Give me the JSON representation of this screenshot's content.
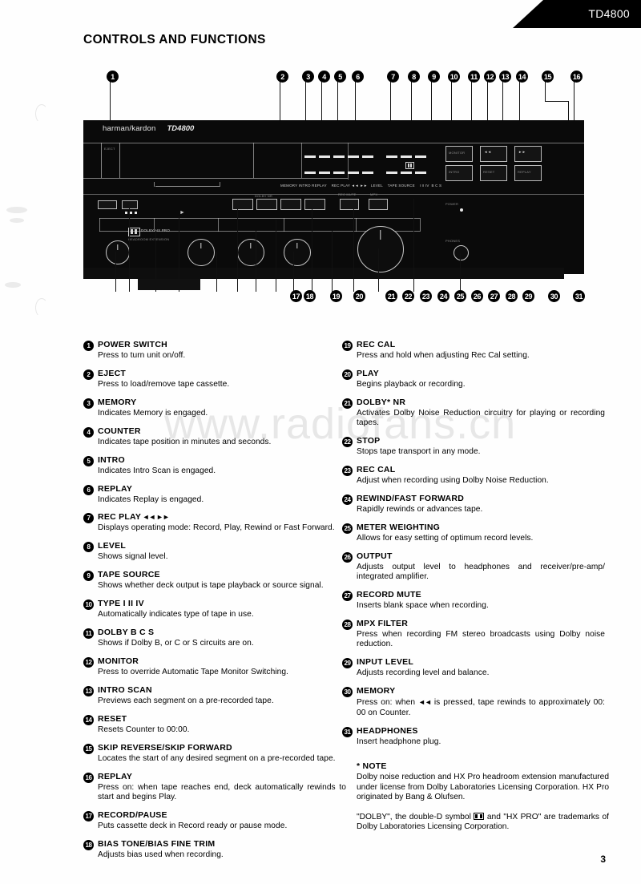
{
  "header": {
    "model": "TD4800"
  },
  "section_title": "CONTROLS AND FUNCTIONS",
  "page_number": "3",
  "watermark": "www.radiofans.cn",
  "illustration": {
    "brand": "harman/kardon",
    "model": "TD4800",
    "dolby_label": "DOLBY HX PRO",
    "dolby_sub": "HEADROOM EXTENSION",
    "callouts_top": [
      "1",
      "2",
      "3",
      "4",
      "5",
      "6",
      "7",
      "8",
      "9",
      "10",
      "11",
      "12",
      "13",
      "14",
      "15",
      "16"
    ],
    "callouts_bottom": [
      "17",
      "18",
      "19",
      "20",
      "21",
      "22",
      "23",
      "24",
      "25",
      "26",
      "27",
      "28",
      "29",
      "30",
      "31"
    ]
  },
  "left_column": [
    {
      "num": "1",
      "name": "POWER SWITCH",
      "desc": "Press to turn unit on/off."
    },
    {
      "num": "2",
      "name": "EJECT",
      "desc": "Press to load/remove tape cassette."
    },
    {
      "num": "3",
      "name": "MEMORY",
      "desc": "Indicates Memory is engaged."
    },
    {
      "num": "4",
      "name": "COUNTER",
      "desc": "Indicates tape position in minutes and seconds."
    },
    {
      "num": "5",
      "name": "INTRO",
      "desc": "Indicates Intro Scan is engaged."
    },
    {
      "num": "6",
      "name": "REPLAY",
      "desc": "Indicates Replay is engaged."
    },
    {
      "num": "7",
      "name": "REC PLAY",
      "name_suffix": "◄◄ ►►",
      "desc": "Displays operating mode: Record, Play, Rewind or Fast Forward."
    },
    {
      "num": "8",
      "name": "LEVEL",
      "desc": "Shows signal level."
    },
    {
      "num": "9",
      "name": "TAPE SOURCE",
      "desc": "Shows whether deck output is tape playback or source signal."
    },
    {
      "num": "10",
      "name": "TYPE I II IV",
      "desc": "Automatically indicates type of tape in use."
    },
    {
      "num": "11",
      "name": "DOLBY B C  S",
      "desc": "Shows if Dolby B, or C or S circuits are on."
    },
    {
      "num": "12",
      "name": "MONITOR",
      "desc": "Press to override Automatic Tape Monitor Switching."
    },
    {
      "num": "13",
      "name": "INTRO SCAN",
      "desc": "Previews each segment on a pre-recorded tape."
    },
    {
      "num": "14",
      "name": "RESET",
      "desc": "Resets Counter to 00:00."
    },
    {
      "num": "15",
      "name": "SKIP REVERSE/SKIP FORWARD",
      "desc": "Locates the start of any desired segment on a pre-recorded tape."
    },
    {
      "num": "16",
      "name": "REPLAY",
      "desc": "Press on: when tape reaches end, deck automatically rewinds to start and begins Play."
    },
    {
      "num": "17",
      "name": "RECORD/PAUSE",
      "desc": "Puts cassette deck in Record ready or pause mode."
    },
    {
      "num": "18",
      "name": "BIAS TONE/BIAS FINE TRIM",
      "desc": "Adjusts bias used when recording."
    }
  ],
  "right_column": [
    {
      "num": "19",
      "name": "REC CAL",
      "desc": "Press and hold when adjusting Rec Cal setting."
    },
    {
      "num": "20",
      "name": "PLAY",
      "desc": "Begins playback or recording."
    },
    {
      "num": "21",
      "name": "DOLBY* NR",
      "desc": "Activates Dolby Noise Reduction circuitry for playing or recording tapes."
    },
    {
      "num": "22",
      "name": "STOP",
      "desc": "Stops tape transport in any mode."
    },
    {
      "num": "23",
      "name": "REC CAL",
      "desc": "Adjust when recording using Dolby Noise Reduction."
    },
    {
      "num": "24",
      "name": "REWIND/FAST FORWARD",
      "desc": "Rapidly rewinds or advances tape."
    },
    {
      "num": "25",
      "name": "METER WEIGHTING",
      "desc": "Allows for easy setting of optimum record levels."
    },
    {
      "num": "26",
      "name": "OUTPUT",
      "desc": "Adjusts output level to headphones and receiver/pre-amp/ integrated amplifier."
    },
    {
      "num": "27",
      "name": "RECORD MUTE",
      "desc": "Inserts blank space when recording."
    },
    {
      "num": "28",
      "name": "MPX FILTER",
      "desc": "Press when recording FM stereo broadcasts using Dolby noise reduction."
    },
    {
      "num": "29",
      "name": "INPUT LEVEL",
      "desc": "Adjusts recording level and balance."
    },
    {
      "num": "30",
      "name": "MEMORY",
      "desc_before": "Press on: when",
      "desc_glyph": "◄◄",
      "desc_after": "is pressed, tape rewinds to approximately 00: 00 on Counter."
    },
    {
      "num": "31",
      "name": "HEADPHONES",
      "desc": "Insert headphone plug."
    }
  ],
  "note": {
    "title": "* NOTE",
    "paragraph1": "Dolby noise reduction and HX Pro headroom extension manufactured under license from Dolby Laboratories Licensing Corporation. HX Pro originated by Bang & Olufsen.",
    "paragraph2_before": "\"DOLBY\", the double-D symbol",
    "paragraph2_after": "and \"HX PRO\" are trademarks of Dolby Laboratories Licensing Corporation."
  }
}
